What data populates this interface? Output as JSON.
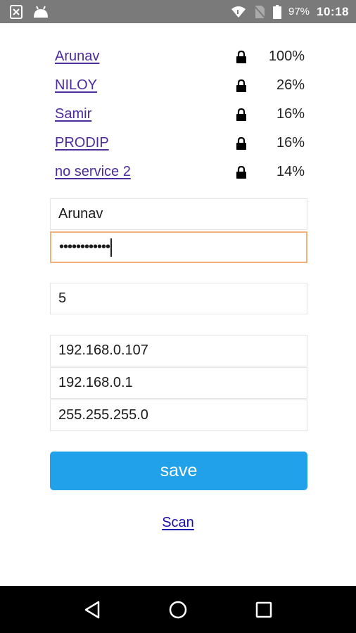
{
  "status_bar": {
    "battery_percent": "97%",
    "time": "10:18",
    "icons": [
      "close-box-icon",
      "android-icon",
      "wifi-icon",
      "no-sim-icon",
      "battery-icon"
    ]
  },
  "networks": [
    {
      "name": "Arunav",
      "signal": "100%",
      "secured": true
    },
    {
      "name": "NILOY",
      "signal": "26%",
      "secured": true
    },
    {
      "name": "Samir",
      "signal": "16%",
      "secured": true
    },
    {
      "name": "PRODIP",
      "signal": "16%",
      "secured": true
    },
    {
      "name": "no service 2",
      "signal": "14%",
      "secured": true
    }
  ],
  "form": {
    "ssid": "Arunav",
    "password_masked": "••••••••••••",
    "number": "5",
    "ip_address": "192.168.0.107",
    "gateway": "192.168.0.1",
    "subnet": "255.255.255.0",
    "save_label": "save"
  },
  "scan_label": "Scan",
  "colors": {
    "link": "#4c2b9d",
    "button": "#20a1ea",
    "focus_border": "#f2b07a"
  }
}
